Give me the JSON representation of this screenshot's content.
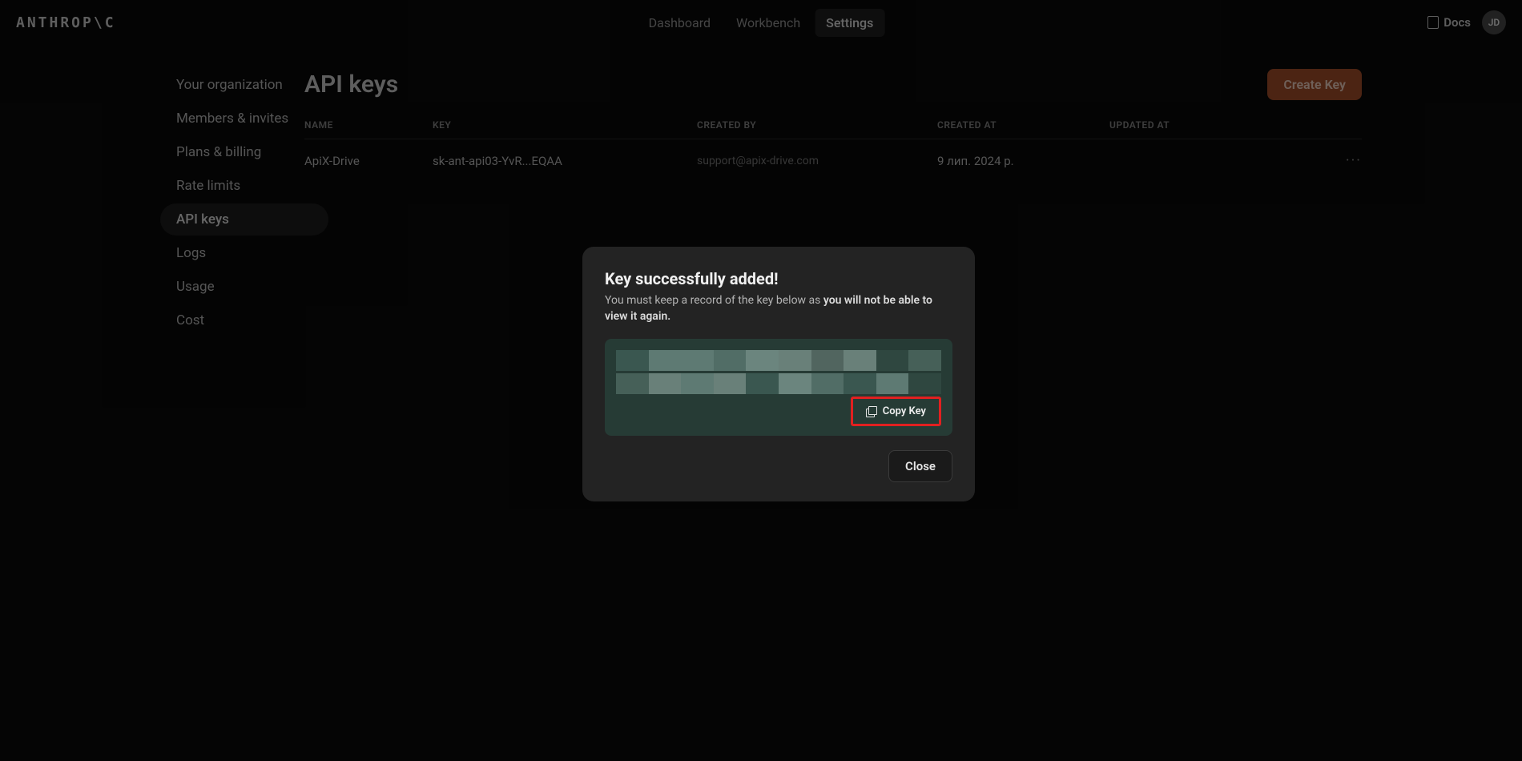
{
  "brand": "ANTHROP\\C",
  "nav": {
    "items": [
      {
        "label": "Dashboard",
        "active": false
      },
      {
        "label": "Workbench",
        "active": false
      },
      {
        "label": "Settings",
        "active": true
      }
    ],
    "docs_label": "Docs",
    "avatar_initials": "JD"
  },
  "sidebar": {
    "items": [
      {
        "label": "Your organization",
        "active": false
      },
      {
        "label": "Members & invites",
        "active": false
      },
      {
        "label": "Plans & billing",
        "active": false
      },
      {
        "label": "Rate limits",
        "active": false
      },
      {
        "label": "API keys",
        "active": true
      },
      {
        "label": "Logs",
        "active": false
      },
      {
        "label": "Usage",
        "active": false
      },
      {
        "label": "Cost",
        "active": false
      }
    ]
  },
  "page": {
    "title": "API keys",
    "create_label": "Create Key"
  },
  "table": {
    "headers": {
      "name": "NAME",
      "key": "KEY",
      "created_by": "CREATED BY",
      "created_at": "CREATED AT",
      "updated_at": "UPDATED AT"
    },
    "rows": [
      {
        "name": "ApiX-Drive",
        "key": "sk-ant-api03-YvR...EQAA",
        "created_by": "support@apix-drive.com",
        "created_at": "9 лип. 2024 р.",
        "updated_at": ""
      }
    ]
  },
  "modal": {
    "title": "Key successfully added!",
    "sub_prefix": "You must keep a record of the key below as ",
    "sub_strong": "you will not be able to view it again.",
    "copy_label": "Copy Key",
    "close_label": "Close",
    "blur_colors_row1": [
      "#3a5750",
      "#5e7a73",
      "#5e7a73",
      "#516d66",
      "#6b857e",
      "#698079",
      "#51655f",
      "#698079",
      "#2f4740",
      "#466058"
    ],
    "blur_colors_row2": [
      "#466058",
      "#698079",
      "#5e7a73",
      "#698079",
      "#3a5750",
      "#6b857e",
      "#516d66",
      "#3a5750",
      "#5e7a73",
      "#2f4740"
    ]
  }
}
